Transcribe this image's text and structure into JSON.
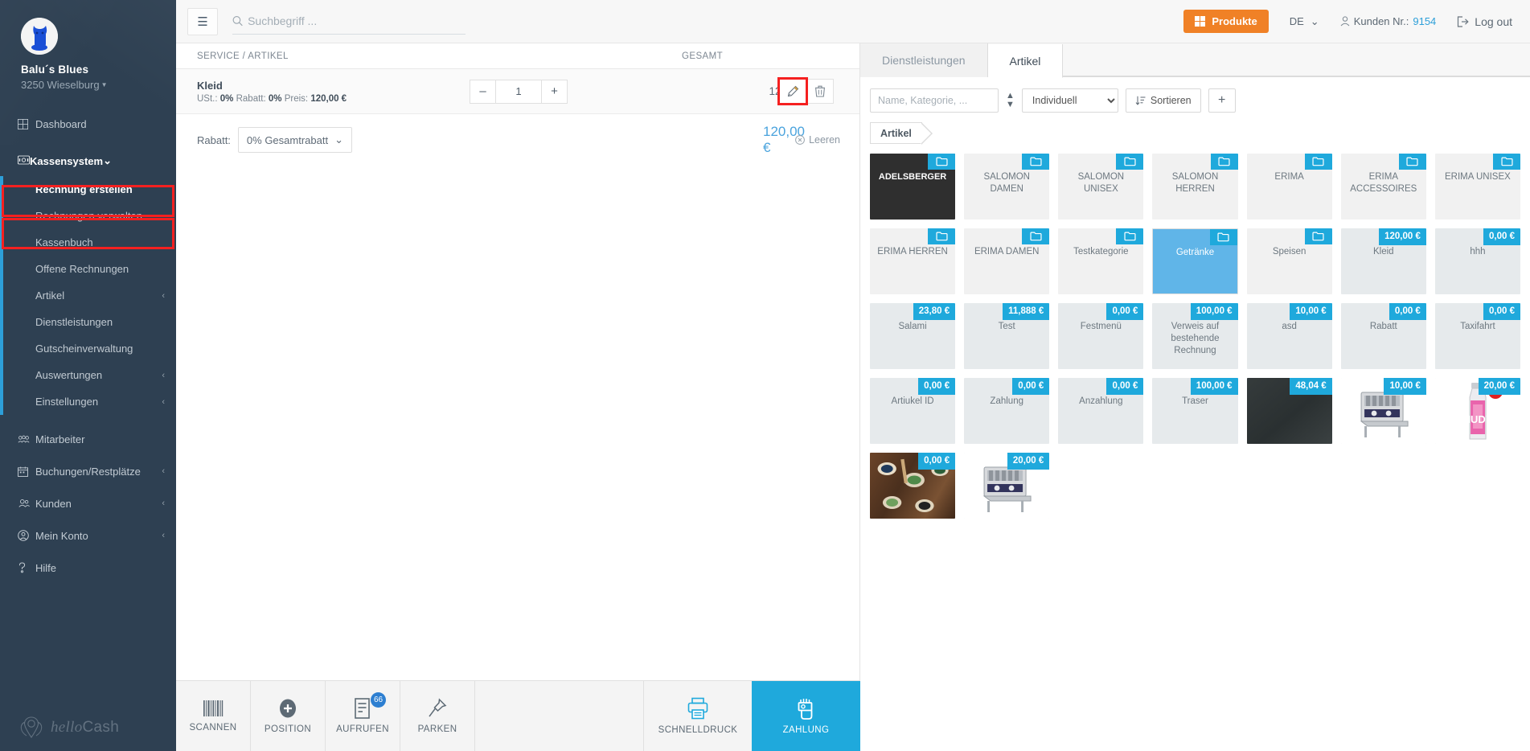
{
  "sidebar": {
    "brand_name": "Balu´s Blues",
    "brand_location": "3250 Wieselburg",
    "dashboard": "Dashboard",
    "group_label": "Kassensystem",
    "sub_items": [
      {
        "label": "Rechnung erstellen",
        "active": true
      },
      {
        "label": "Rechnungen verwalten",
        "active": false
      },
      {
        "label": "Kassenbuch",
        "active": false
      },
      {
        "label": "Offene Rechnungen",
        "active": false
      },
      {
        "label": "Artikel",
        "active": false,
        "chevron": "‹"
      },
      {
        "label": "Dienstleistungen",
        "active": false
      },
      {
        "label": "Gutscheinverwaltung",
        "active": false
      },
      {
        "label": "Auswertungen",
        "active": false,
        "chevron": "‹"
      },
      {
        "label": "Einstellungen",
        "active": false,
        "chevron": "‹"
      }
    ],
    "bottom_items": [
      {
        "label": "Mitarbeiter",
        "icon": "users-icon",
        "chevron": ""
      },
      {
        "label": "Buchungen/Restplätze",
        "icon": "calendar-icon",
        "chevron": "‹"
      },
      {
        "label": "Kunden",
        "icon": "people-icon",
        "chevron": "‹"
      },
      {
        "label": "Mein Konto",
        "icon": "account-icon",
        "chevron": "‹"
      },
      {
        "label": "Hilfe",
        "icon": "help-icon",
        "chevron": ""
      }
    ],
    "logo_italic": "hello",
    "logo_plain": "Cash"
  },
  "topbar": {
    "menu_icon": "hamburger-icon",
    "search_placeholder": "Suchbegriff ...",
    "search_value": "",
    "produkte_label": "Produkte",
    "language": "DE",
    "customer_label": "Kunden Nr.:",
    "customer_number": "9154",
    "logout_label": "Log out"
  },
  "cart": {
    "col_service": "SERVICE / ARTIKEL",
    "col_total": "GESAMT",
    "items": [
      {
        "name": "Kleid",
        "meta_ust_label": "USt.:",
        "meta_ust": "0%",
        "meta_rabatt_label": "Rabatt:",
        "meta_rabatt": "0%",
        "meta_preis_label": "Preis:",
        "meta_preis": "120,00 €",
        "qty": "1",
        "minus": "–",
        "plus": "+",
        "line_total": "120,00 €",
        "edit_icon": "pencil-icon",
        "delete_icon": "trash-icon"
      }
    ],
    "discount_label": "Rabatt:",
    "discount_value": "0% Gesamtrabatt",
    "grand_total": "120,00 €",
    "clear_label": "Leeren"
  },
  "products": {
    "tabs": [
      {
        "label": "Dienstleistungen",
        "active": false
      },
      {
        "label": "Artikel",
        "active": true
      }
    ],
    "filter_placeholder": "Name, Kategorie, ...",
    "filter_value": "",
    "sort_mode": "Individuell",
    "sort_options": [
      "Individuell"
    ],
    "sort_button": "Sortieren",
    "add_button": "+",
    "breadcrumb": "Artikel",
    "cards": [
      {
        "label": "ADELSBERGER",
        "badge": "folder",
        "style": "dark"
      },
      {
        "label": "SALOMON DAMEN",
        "badge": "folder",
        "style": "folder"
      },
      {
        "label": "SALOMON UNISEX",
        "badge": "folder",
        "style": "folder"
      },
      {
        "label": "SALOMON HERREN",
        "badge": "folder",
        "style": "folder"
      },
      {
        "label": "ERIMA",
        "badge": "folder",
        "style": "folder"
      },
      {
        "label": "ERIMA ACCESSOIRES",
        "badge": "folder",
        "style": "folder"
      },
      {
        "label": "ERIMA UNISEX",
        "badge": "folder",
        "style": "folder"
      },
      {
        "label": "ERIMA HERREN",
        "badge": "folder",
        "style": "folder"
      },
      {
        "label": "ERIMA DAMEN",
        "badge": "folder",
        "style": "folder"
      },
      {
        "label": "Testkategorie",
        "badge": "folder",
        "style": "folder"
      },
      {
        "label": "Getränke",
        "badge": "folder",
        "style": "selected"
      },
      {
        "label": "Speisen",
        "badge": "folder",
        "style": "folder"
      },
      {
        "label": "Kleid",
        "badge": "120,00 €",
        "style": "item"
      },
      {
        "label": "hhh",
        "badge": "0,00 €",
        "style": "item"
      },
      {
        "label": "Salami",
        "badge": "23,80 €",
        "style": "item"
      },
      {
        "label": "Test",
        "badge": "11,888 €",
        "style": "item"
      },
      {
        "label": "Festmenü",
        "badge": "0,00 €",
        "style": "item"
      },
      {
        "label": "Verweis auf bestehende Rechnung",
        "badge": "100,00 €",
        "style": "item"
      },
      {
        "label": "asd",
        "badge": "10,00 €",
        "style": "item"
      },
      {
        "label": "Rabatt",
        "badge": "0,00 €",
        "style": "item"
      },
      {
        "label": "Taxifahrt",
        "badge": "0,00 €",
        "style": "item"
      },
      {
        "label": "Artiukel ID",
        "badge": "0,00 €",
        "style": "item"
      },
      {
        "label": "Zahlung",
        "badge": "0,00 €",
        "style": "item"
      },
      {
        "label": "Anzahlung",
        "badge": "0,00 €",
        "style": "item"
      },
      {
        "label": "Traser",
        "badge": "100,00 €",
        "style": "item"
      },
      {
        "label": "",
        "badge": "48,04 €",
        "style": "image-dark"
      },
      {
        "label": "",
        "badge": "10,00 €",
        "style": "image-toaster"
      },
      {
        "label": "",
        "badge": "20,00 €",
        "style": "image-bottle"
      },
      {
        "label": "",
        "badge": "0,00 €",
        "style": "image-spices"
      },
      {
        "label": "",
        "badge": "20,00 €",
        "style": "image-toaster"
      }
    ]
  },
  "bottombar": {
    "buttons": [
      {
        "label": "SCANNEN",
        "icon": "barcode-icon",
        "badge": "",
        "variant": "normal"
      },
      {
        "label": "POSITION",
        "icon": "plus-circle-icon",
        "badge": "",
        "variant": "normal"
      },
      {
        "label": "AUFRUFEN",
        "icon": "document-icon",
        "badge": "66",
        "variant": "normal"
      },
      {
        "label": "PARKEN",
        "icon": "pin-icon",
        "badge": "",
        "variant": "normal"
      },
      {
        "label": "SCHNELLDRUCK",
        "icon": "printer-icon",
        "badge": "",
        "variant": "wide"
      },
      {
        "label": "ZAHLUNG",
        "icon": "payment-hand-icon",
        "badge": "",
        "variant": "pay"
      }
    ]
  },
  "colors": {
    "sidebar_bg": "#2e4052",
    "accent_blue": "#1fa9dc",
    "orange": "#f08126",
    "highlight_red": "#f52020",
    "selected_card": "#60b5e8"
  }
}
